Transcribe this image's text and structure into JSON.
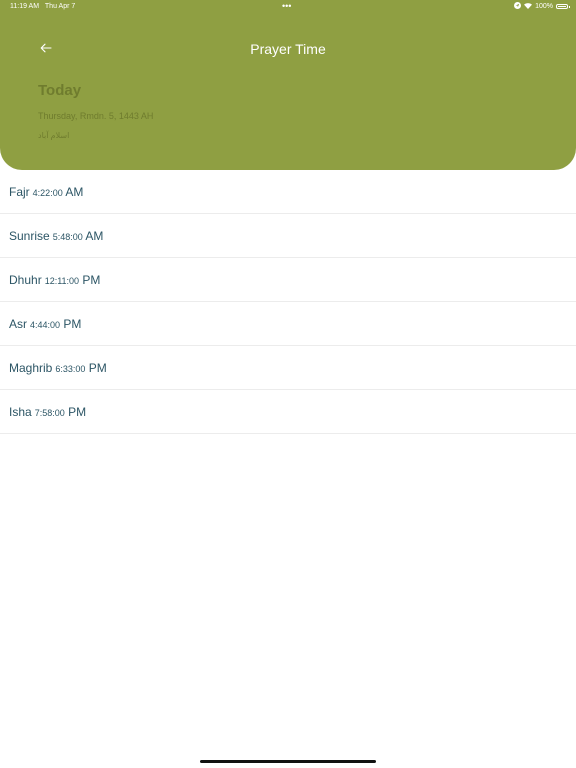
{
  "status_bar": {
    "time": "11:19 AM",
    "date": "Thu Apr 7",
    "dots": "•••",
    "battery": "100%"
  },
  "header": {
    "title": "Prayer Time",
    "back_icon": "arrow-left-icon",
    "today_label": "Today",
    "hijri_date": "Thursday, Rmdn. 5, 1443 AH",
    "arabic_text": "اسلام آباد"
  },
  "prayers": [
    {
      "name": "Fajr",
      "hm": "4:22:00",
      "ampm": "AM"
    },
    {
      "name": "Sunrise",
      "hm": "5:48:00",
      "ampm": "AM"
    },
    {
      "name": "Dhuhr",
      "hm": "12:11:00",
      "ampm": "PM"
    },
    {
      "name": "Asr",
      "hm": "4:44:00",
      "ampm": "PM"
    },
    {
      "name": "Maghrib",
      "hm": "6:33:00",
      "ampm": "PM"
    },
    {
      "name": "Isha",
      "hm": "7:58:00",
      "ampm": "PM"
    }
  ],
  "colors": {
    "header_bg": "#8f9f42",
    "header_text_muted": "#6f7c2e",
    "row_text": "#2c5565"
  }
}
